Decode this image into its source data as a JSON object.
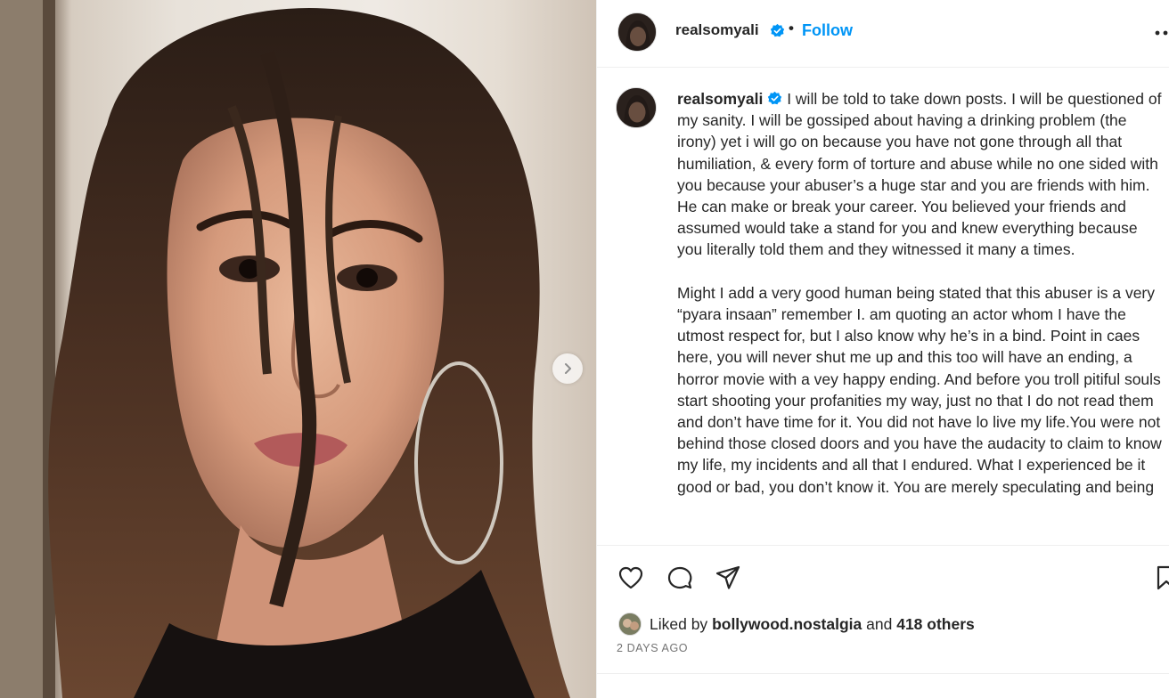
{
  "media": {
    "next_label": "Next"
  },
  "post": {
    "username": "realsomyali",
    "separator": "•",
    "follow_label": "Follow",
    "caption_username": "realsomyali",
    "caption_paragraph_1": "I will be told to take down posts. I will be questioned of my sanity. I will be gossiped about having a drinking problem (the irony) yet i will go on because you have not gone through all that humiliation, & every form of torture and abuse while no one sided with you because your abuser’s a huge star and you are friends with him. He can make or break your career. You believed your friends and assumed would take a stand for you and knew everything because you literally told them and they witnessed it many a times.",
    "caption_paragraph_2": "Might I add a very good human being stated that this abuser is a very “pyara insaan” remember I. am quoting an actor whom I have the utmost respect for, but I also know why he’s in a bind. Point in caes here, you will never shut me up and this too will have an ending, a horror movie with a vey happy ending. And before you troll pitiful souls start shooting your profanities my way, just no that I do not read them and don’t have time for it. You did not have lo live my life.You were not behind those closed doors and you have the audacity to claim to know my life, my incidents and all that I endured. What I experienced be it good or bad, you don’t know it. You are merely speculating and being"
  },
  "actions": {
    "icons": [
      "heart-icon",
      "comment-icon",
      "share-icon",
      "bookmark-icon"
    ]
  },
  "likes": {
    "prefix": "Liked by",
    "liker": "bollywood.nostalgia",
    "conjunction": "and",
    "others": "418 others"
  },
  "timestamp": "2 DAYS AGO",
  "colors": {
    "accent": "#0095f6",
    "text": "#262626",
    "muted": "#737373",
    "border": "#efefef",
    "verified": "#0095f6"
  }
}
